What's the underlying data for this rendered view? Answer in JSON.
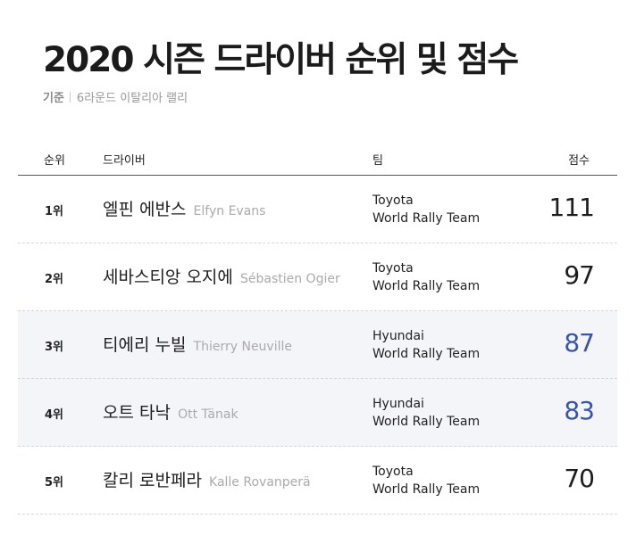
{
  "title": "2020 시즌 드라이버 순위 및 점수",
  "subtitle": {
    "label": "기준",
    "value": "6라운드 이탈리아 랠리"
  },
  "headers": {
    "rank": "순위",
    "driver": "드라이버",
    "team": "팀",
    "score": "점수"
  },
  "accent_color": "#3a55a6",
  "rows": [
    {
      "rank": "1위",
      "name_ko": "엘핀 에반스",
      "name_en": "Elfyn Evans",
      "team_line1": "Toyota",
      "team_line2": "World Rally Team",
      "score": "111"
    },
    {
      "rank": "2위",
      "name_ko": "세바스티앙 오지에",
      "name_en": "Sébastien Ogier",
      "team_line1": "Toyota",
      "team_line2": "World Rally Team",
      "score": "97"
    },
    {
      "rank": "3위",
      "name_ko": "티에리 누빌",
      "name_en": "Thierry Neuville",
      "team_line1": "Hyundai",
      "team_line2": "World Rally Team",
      "score": "87"
    },
    {
      "rank": "4위",
      "name_ko": "오트 타낙",
      "name_en": "Ott Tänak",
      "team_line1": "Hyundai",
      "team_line2": "World Rally Team",
      "score": "83"
    },
    {
      "rank": "5위",
      "name_ko": "칼리 로반페라",
      "name_en": "Kalle Rovanperä",
      "team_line1": "Toyota",
      "team_line2": "World Rally Team",
      "score": "70"
    }
  ]
}
